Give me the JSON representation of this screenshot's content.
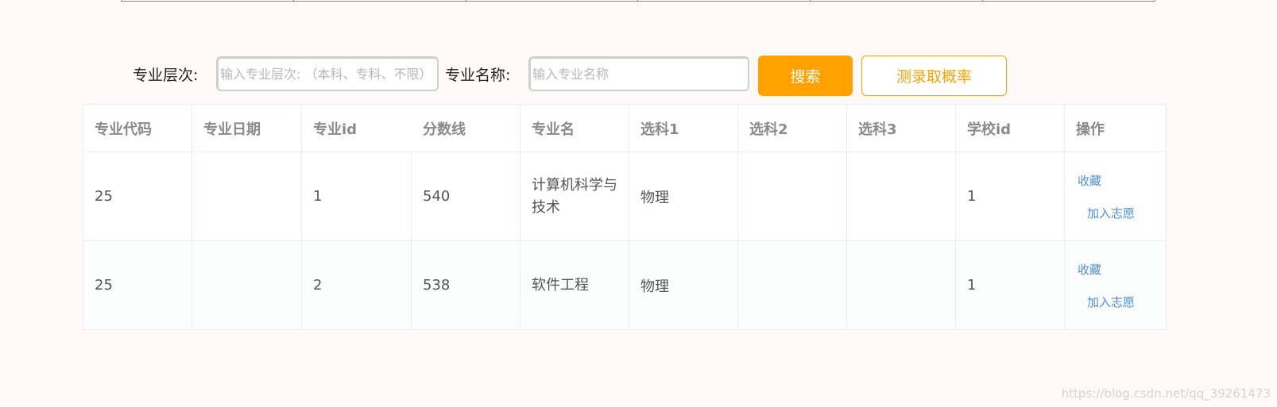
{
  "search": {
    "level_label": "专业层次:",
    "level_placeholder": "输入专业层次: （本科、专科、不限）",
    "name_label": "专业名称:",
    "name_placeholder": "输入专业名称",
    "search_button": "搜索",
    "test_button": "测录取概率"
  },
  "table": {
    "headers": [
      "专业代码",
      "专业日期",
      "专业id",
      "分数线",
      "专业名",
      "选科1",
      "选科2",
      "选科3",
      "学校id",
      "操作"
    ],
    "rows": [
      {
        "code": "25",
        "date": "",
        "id": "1",
        "score": "540",
        "name": "计算机科学与技术",
        "subject1": "物理",
        "subject2": "",
        "subject3": "",
        "school_id": "1",
        "fav": "收藏",
        "wish": "加入志愿"
      },
      {
        "code": "25",
        "date": "",
        "id": "2",
        "score": "538",
        "name": "软件工程",
        "subject1": "物理",
        "subject2": "",
        "subject3": "",
        "school_id": "1",
        "fav": "收藏",
        "wish": "加入志愿"
      }
    ]
  },
  "watermark": "https://blog.csdn.net/qq_39261473"
}
